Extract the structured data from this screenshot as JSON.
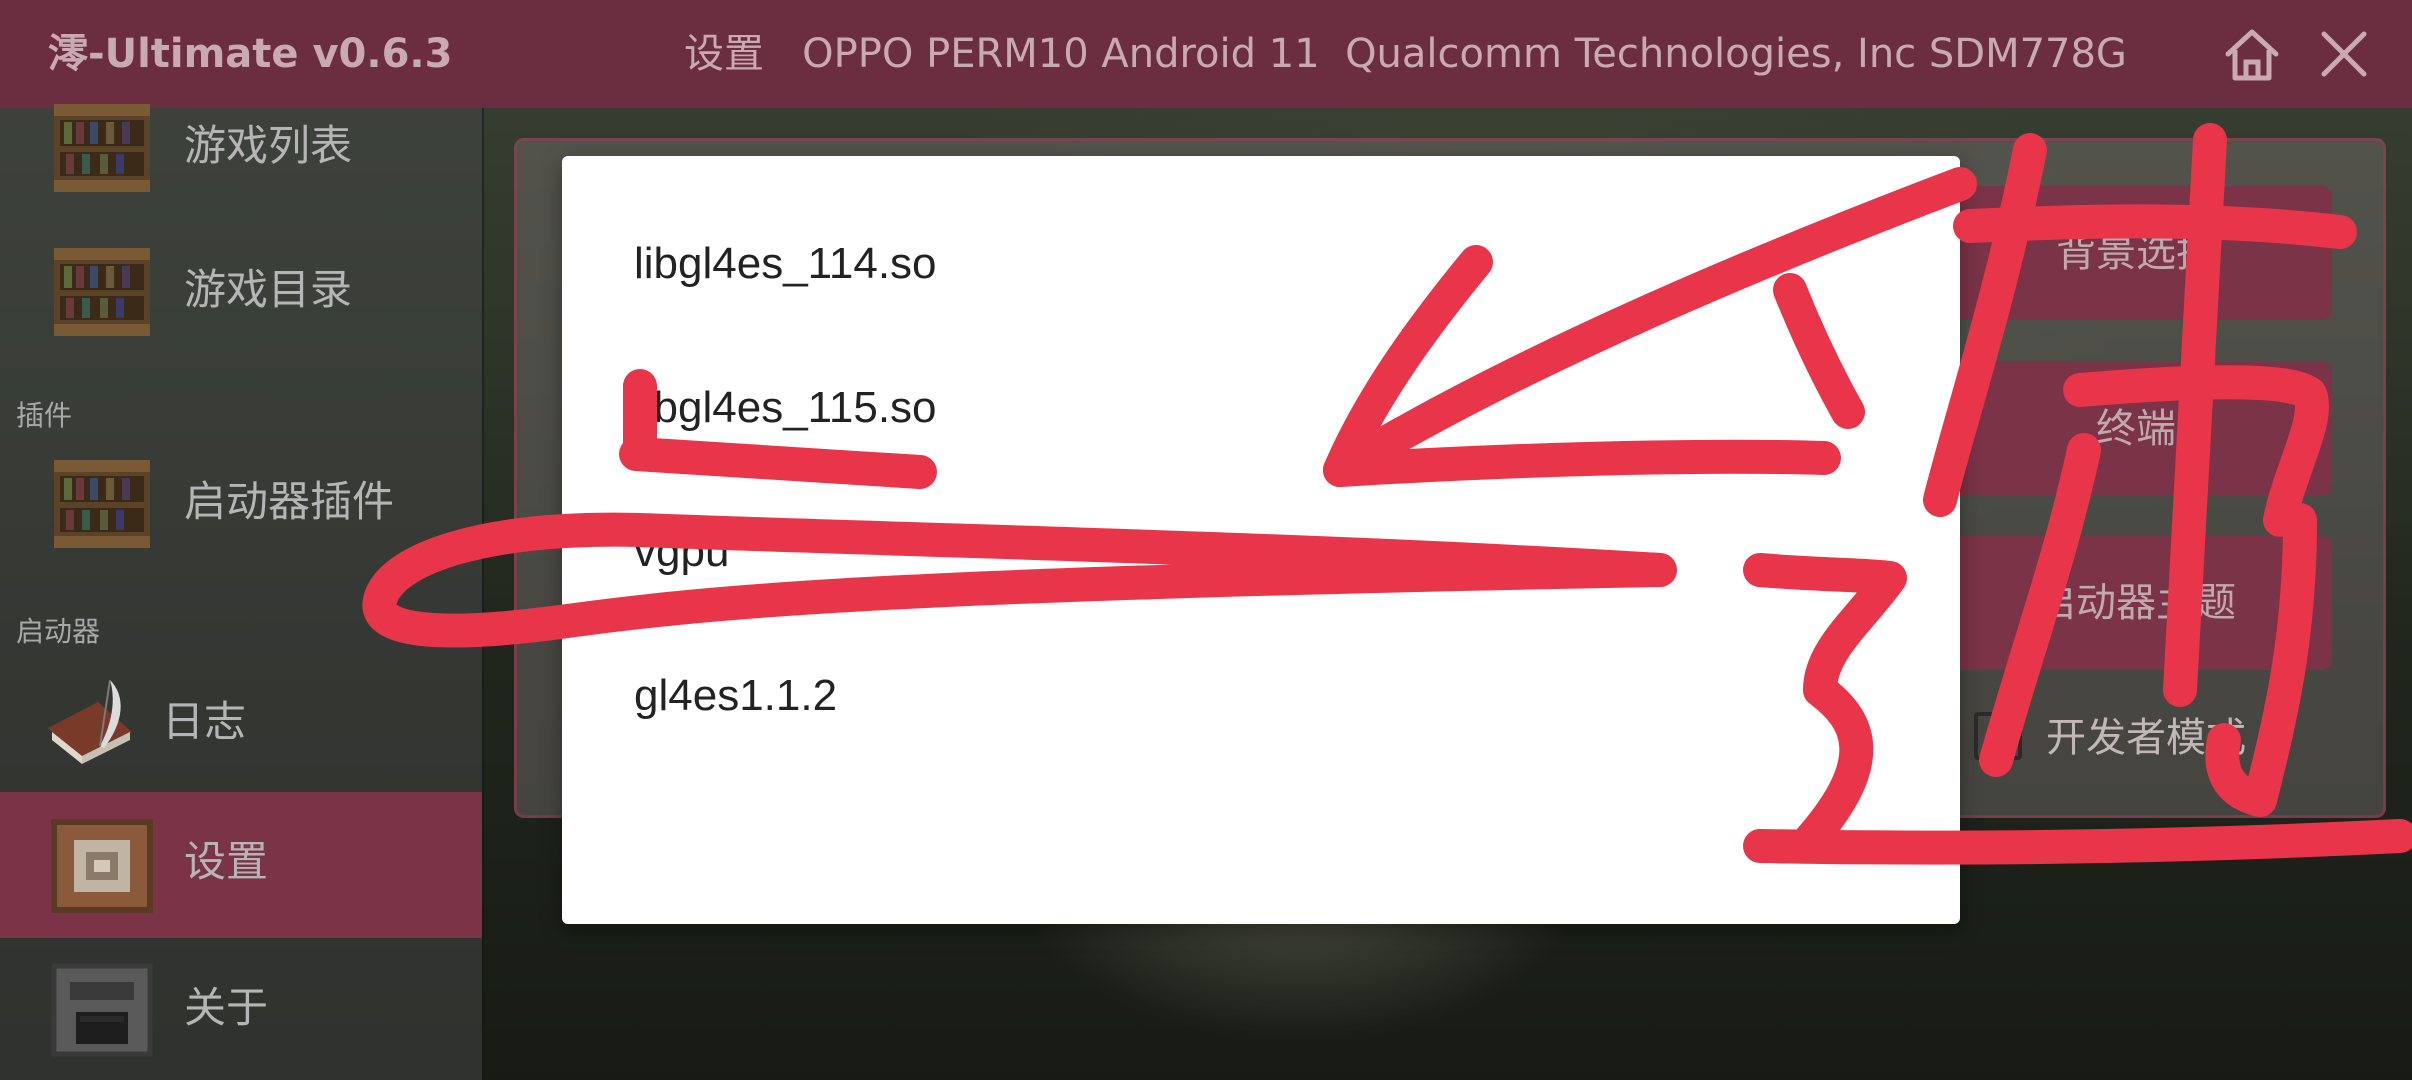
{
  "header": {
    "app_title": "澪-Ultimate v0.6.3",
    "device_info": "设置   OPPO PERM10 Android 11  Qualcomm Technologies, Inc SDM778G",
    "home_icon": "home-icon",
    "close_icon": "close-icon"
  },
  "sidebar": {
    "items": [
      {
        "label": "游戏列表",
        "icon": "bookshelf-icon"
      },
      {
        "label": "游戏目录",
        "icon": "bookshelf-icon"
      },
      {
        "label": "启动器插件",
        "icon": "bookshelf-icon"
      },
      {
        "label": "日志",
        "icon": "book-quill-icon"
      },
      {
        "label": "设置",
        "icon": "command-block-icon",
        "selected": true
      },
      {
        "label": "关于",
        "icon": "furnace-icon"
      }
    ],
    "sections": {
      "plugins": "插件",
      "launcher": "启动器"
    }
  },
  "panel": {
    "buttons": [
      "背景选择",
      "终端",
      "启动器主题"
    ],
    "developer_mode_label": "开发者模式",
    "developer_mode_checked": false
  },
  "dialog": {
    "options": [
      "libgl4es_114.so",
      "libgl4es_115.so",
      "vgpu",
      "gl4es1.1.2"
    ]
  },
  "colors": {
    "accent": "#7a3347",
    "topbar": "#6b2e40",
    "annotation": "#e8354a"
  }
}
